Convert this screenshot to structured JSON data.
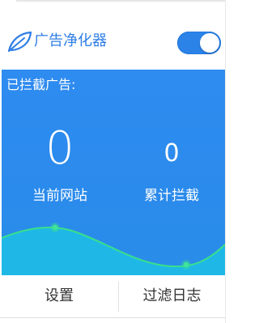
{
  "header": {
    "logo_icon": "leaf-icon",
    "title": "广告净化器",
    "title_color": "#2f7ee6",
    "toggle_state": "on",
    "toggle_color": "#2b83e8"
  },
  "panel": {
    "blocked_label": "已拦截广告:",
    "background_color": "#2e8bf0",
    "wave_color": "#21c6e3",
    "wave_line_color": "#39e08a",
    "stats": [
      {
        "value": "0",
        "label": "当前网站"
      },
      {
        "value": "0",
        "label": "累计拦截"
      }
    ]
  },
  "footer": {
    "settings_label": "设置",
    "log_label": "过滤日志"
  }
}
